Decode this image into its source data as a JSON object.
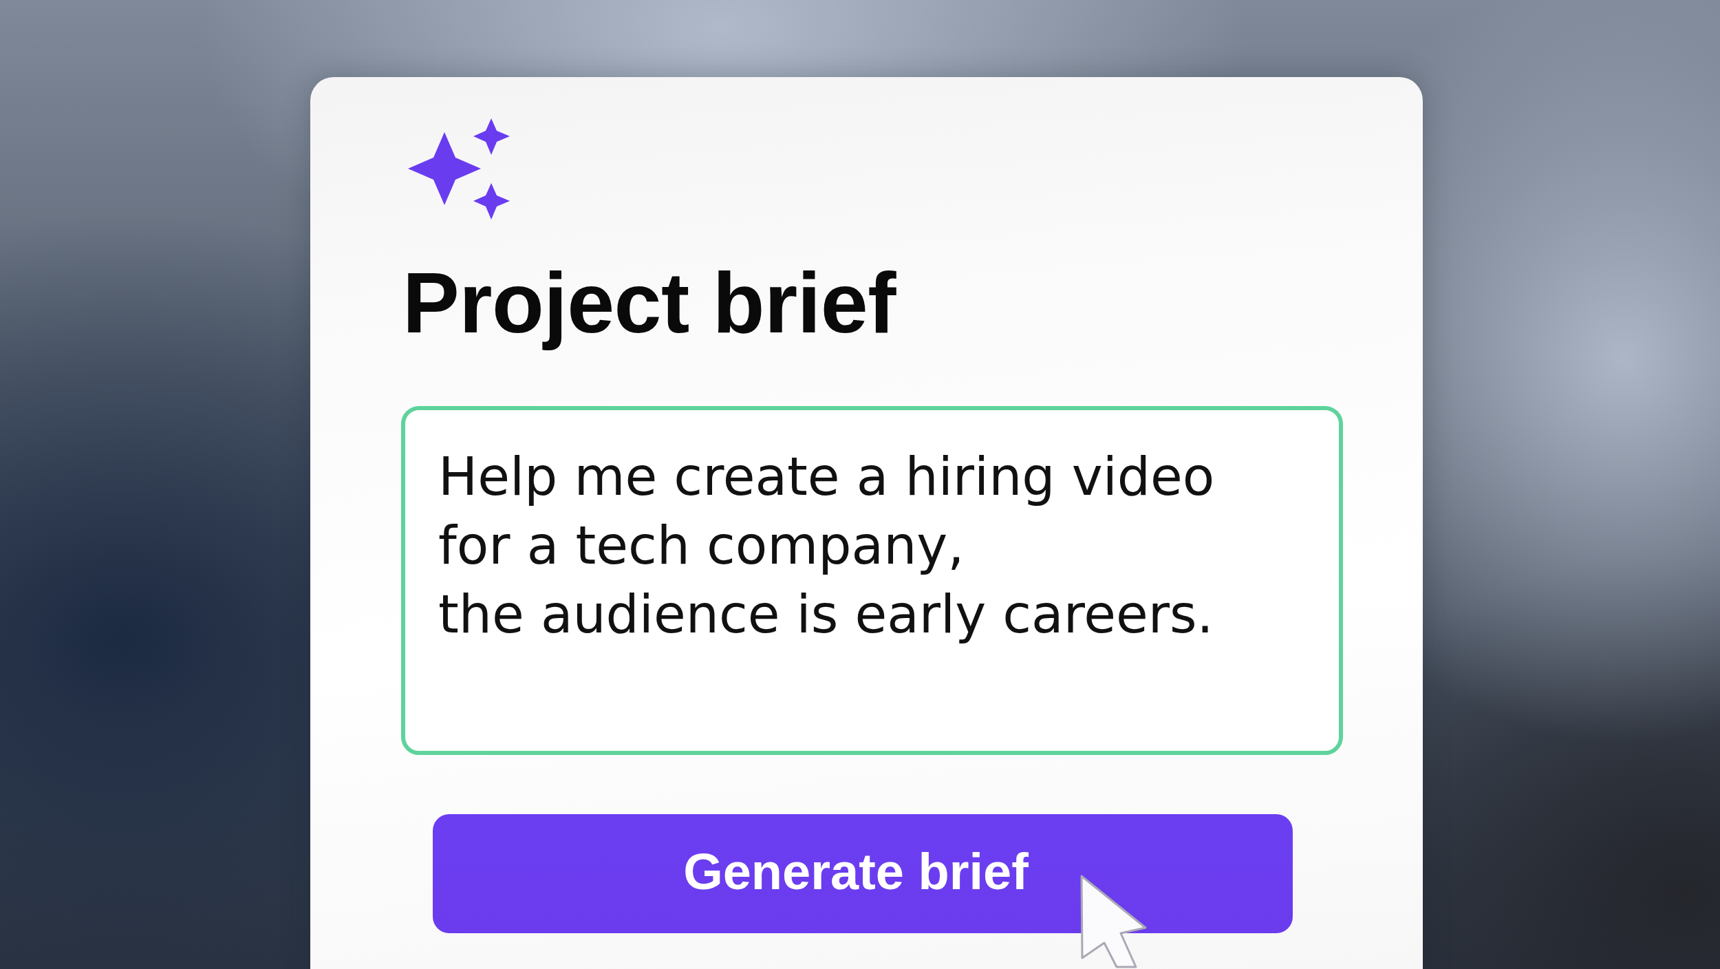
{
  "panel": {
    "title": "Project brief",
    "prompt": {
      "value": "Help me create a hiring video\nfor a tech company,\nthe audience is early careers."
    },
    "button": {
      "label": "Generate brief",
      "hovered": true
    }
  }
}
